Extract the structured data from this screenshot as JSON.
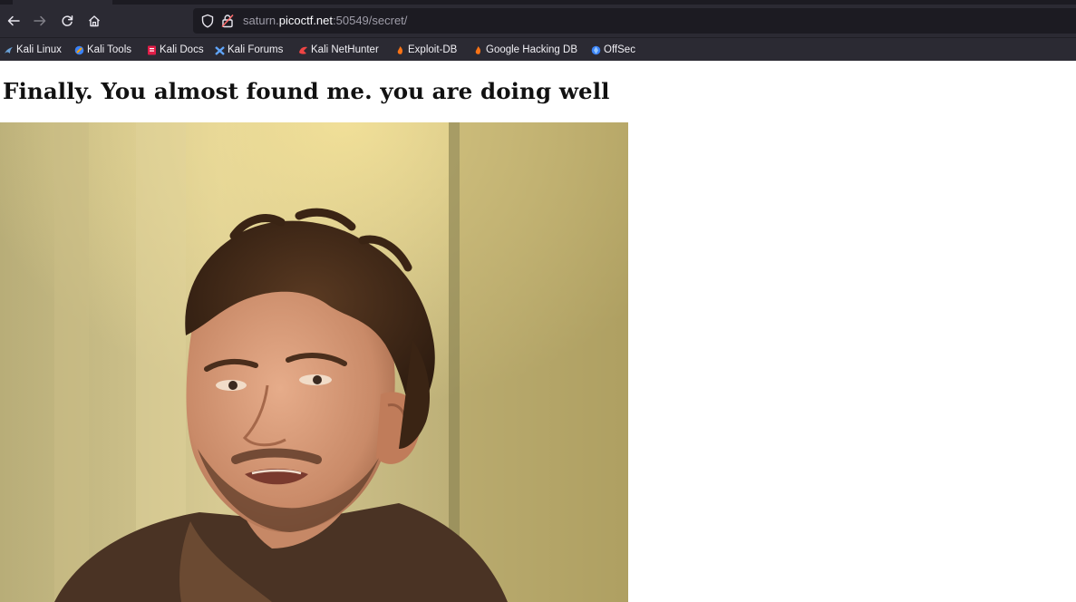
{
  "browser": {
    "url": {
      "prefix": "saturn.",
      "host": "picoctf.net",
      "suffix": ":50549/secret/"
    },
    "nav": [
      "back-arrow-icon",
      "forward-arrow-icon",
      "reload-icon",
      "home-icon"
    ],
    "bookmarks": [
      {
        "label": "Kali Linux",
        "icon": "kali-dragon-icon",
        "color": "#6aa1d8"
      },
      {
        "label": "Kali Tools",
        "icon": "kali-tools-icon",
        "color": "#3b82f6"
      },
      {
        "label": "Kali Docs",
        "icon": "kali-docs-icon",
        "color": "#e11d48"
      },
      {
        "label": "Kali Forums",
        "icon": "kali-forums-icon",
        "color": "#60a5fa"
      },
      {
        "label": "Kali NetHunter",
        "icon": "nethunter-icon",
        "color": "#ef4444"
      },
      {
        "label": "Exploit-DB",
        "icon": "exploit-db-icon",
        "color": "#f97316"
      },
      {
        "label": "Google Hacking DB",
        "icon": "ghdb-icon",
        "color": "#f97316"
      },
      {
        "label": "OffSec",
        "icon": "offsec-icon",
        "color": "#3b82f6"
      }
    ]
  },
  "page": {
    "heading": "Finally. You almost found me. you are doing well"
  },
  "colors": {
    "chrome_bg": "#2b2a33",
    "urlbar_bg": "#1c1b22",
    "page_bg": "#ffffff"
  }
}
